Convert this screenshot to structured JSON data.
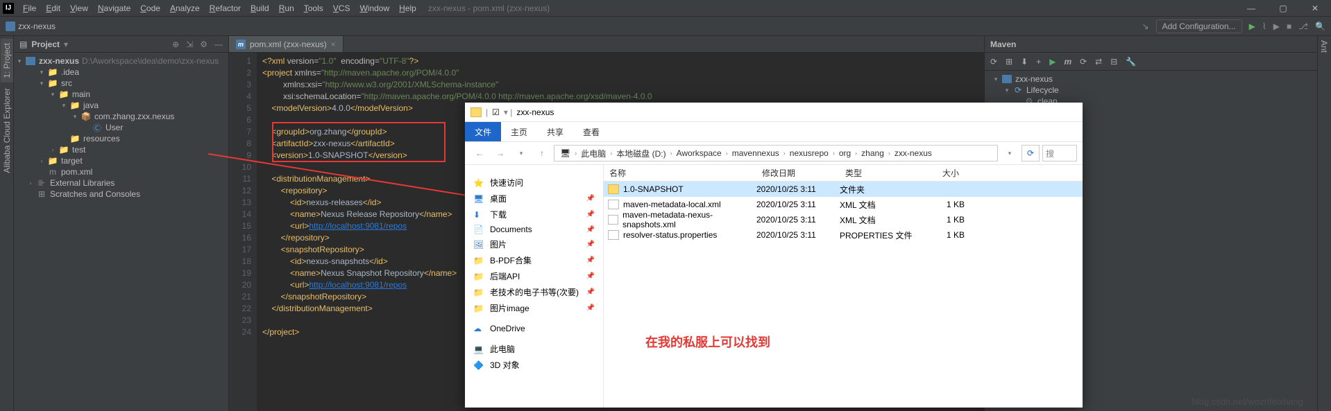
{
  "menu": {
    "items": [
      "File",
      "Edit",
      "View",
      "Navigate",
      "Code",
      "Analyze",
      "Refactor",
      "Build",
      "Run",
      "Tools",
      "VCS",
      "Window",
      "Help"
    ],
    "title": "zxx-nexus - pom.xml (zxx-nexus)"
  },
  "navbar": {
    "crumb": "zxx-nexus",
    "add_conf": "Add Configuration..."
  },
  "project": {
    "title": "Project",
    "root": {
      "label": "zxx-nexus",
      "path": "D:\\Aworkspace\\idea\\demo\\zxx-nexus"
    },
    "tree": [
      {
        "ind": 1,
        "arrow": "▾",
        "icon": "folder",
        "label": ".idea"
      },
      {
        "ind": 1,
        "arrow": "▾",
        "icon": "folder-blue",
        "label": "src"
      },
      {
        "ind": 2,
        "arrow": "▾",
        "icon": "folder-blue",
        "label": "main"
      },
      {
        "ind": 3,
        "arrow": "▾",
        "icon": "folder-blue",
        "label": "java"
      },
      {
        "ind": 4,
        "arrow": "▾",
        "icon": "package",
        "label": "com.zhang.zxx.nexus"
      },
      {
        "ind": 5,
        "arrow": "",
        "icon": "class",
        "label": "User"
      },
      {
        "ind": 3,
        "arrow": "",
        "icon": "folder",
        "label": "resources"
      },
      {
        "ind": 2,
        "arrow": "›",
        "icon": "folder",
        "label": "test"
      },
      {
        "ind": 1,
        "arrow": "›",
        "icon": "folder-orange",
        "label": "target"
      },
      {
        "ind": 1,
        "arrow": "",
        "icon": "maven",
        "label": "pom.xml"
      },
      {
        "ind": 0,
        "arrow": "›",
        "icon": "lib",
        "label": "External Libraries"
      },
      {
        "ind": 0,
        "arrow": "",
        "icon": "scratch",
        "label": "Scratches and Consoles"
      }
    ]
  },
  "editor": {
    "tab": "pom.xml (zxx-nexus)",
    "lines": [
      {
        "n": 1,
        "html": "<span class='tag'>&lt;?xml</span> <span class='attr'>version</span>=<span class='str'>\"1.0\"</span>  <span class='attr'>encoding</span>=<span class='str'>\"UTF-8\"</span><span class='tag'>?&gt;</span>"
      },
      {
        "n": 2,
        "html": "<span class='tag'>&lt;project</span> <span class='attr'>xmlns</span>=<span class='str'>\"http://maven.apache.org/POM/4.0.0\"</span>"
      },
      {
        "n": 3,
        "html": "         <span class='attr'>xmlns:xsi</span>=<span class='str'>\"http://www.w3.org/2001/XMLSchema-instance\"</span>"
      },
      {
        "n": 4,
        "html": "         <span class='attr'>xsi:schemaLocation</span>=<span class='str'>\"http://maven.apache.org/POM/4.0.0 http://maven.apache.org/xsd/maven-4.0.0</span>"
      },
      {
        "n": 5,
        "html": "    <span class='tag'>&lt;modelVersion&gt;</span><span class='txt'>4.0.0</span><span class='tag'>&lt;/modelVersion&gt;</span>"
      },
      {
        "n": 6,
        "html": ""
      },
      {
        "n": 7,
        "html": "    <span class='tag'>&lt;groupId&gt;</span><span class='txt'>org.zhang</span><span class='tag'>&lt;/groupId&gt;</span>"
      },
      {
        "n": 8,
        "html": "    <span class='tag'>&lt;artifactId&gt;</span><span class='txt'>zxx-nexus</span><span class='tag'>&lt;/artifactId&gt;</span>"
      },
      {
        "n": 9,
        "html": "    <span class='tag'>&lt;version&gt;</span><span class='txt'>1.0-SNAPSHOT</span><span class='tag'>&lt;/version&gt;</span>"
      },
      {
        "n": 10,
        "html": ""
      },
      {
        "n": 11,
        "html": "    <span class='tag'>&lt;distributionManagement&gt;</span>"
      },
      {
        "n": 12,
        "html": "        <span class='tag'>&lt;repository&gt;</span>"
      },
      {
        "n": 13,
        "html": "            <span class='tag'>&lt;id&gt;</span><span class='txt'>nexus-releases</span><span class='tag'>&lt;/id&gt;</span>"
      },
      {
        "n": 14,
        "html": "            <span class='tag'>&lt;name&gt;</span><span class='txt'>Nexus Release Repository</span><span class='tag'>&lt;/name&gt;</span>"
      },
      {
        "n": 15,
        "html": "            <span class='tag'>&lt;url&gt;</span><span class='url'>http://localhost:9081/repos</span>"
      },
      {
        "n": 16,
        "html": "        <span class='tag'>&lt;/repository&gt;</span>"
      },
      {
        "n": 17,
        "html": "        <span class='tag'>&lt;snapshotRepository&gt;</span>"
      },
      {
        "n": 18,
        "html": "            <span class='tag'>&lt;id&gt;</span><span class='txt'>nexus-snapshots</span><span class='tag'>&lt;/id&gt;</span>"
      },
      {
        "n": 19,
        "html": "            <span class='tag'>&lt;name&gt;</span><span class='txt'>Nexus Snapshot Repository</span><span class='tag'>&lt;/name&gt;</span>"
      },
      {
        "n": 20,
        "html": "            <span class='tag'>&lt;url&gt;</span><span class='url'>http://localhost:9081/repos</span>"
      },
      {
        "n": 21,
        "html": "        <span class='tag'>&lt;/snapshotRepository&gt;</span>"
      },
      {
        "n": 22,
        "html": "    <span class='tag'>&lt;/distributionManagement&gt;</span>"
      },
      {
        "n": 23,
        "html": ""
      },
      {
        "n": 24,
        "html": "<span class='tag'>&lt;/project&gt;</span>"
      }
    ]
  },
  "maven": {
    "title": "Maven",
    "root": "zxx-nexus",
    "lifecycle": "Lifecycle",
    "clean": "clean"
  },
  "explorer": {
    "title": "zxx-nexus",
    "tabs": [
      "文件",
      "主页",
      "共享",
      "查看"
    ],
    "crumbs": [
      "此电脑",
      "本地磁盘 (D:)",
      "Aworkspace",
      "mavennexus",
      "nexusrepo",
      "org",
      "zhang",
      "zxx-nexus"
    ],
    "search_placeholder": "搜",
    "nav": [
      {
        "label": "快速访问",
        "icon": "star"
      },
      {
        "label": "桌面",
        "icon": "desktop",
        "pin": true
      },
      {
        "label": "下载",
        "icon": "download",
        "pin": true
      },
      {
        "label": "Documents",
        "icon": "doc",
        "pin": true
      },
      {
        "label": "图片",
        "icon": "pic",
        "pin": true
      },
      {
        "label": "B-PDF合集",
        "icon": "folder",
        "pin": true
      },
      {
        "label": "后端API",
        "icon": "folder",
        "pin": true
      },
      {
        "label": "老技术的电子书等(次要)",
        "icon": "folder",
        "pin": true
      },
      {
        "label": "图片image",
        "icon": "folder",
        "pin": true
      },
      {
        "label": "OneDrive",
        "icon": "cloud"
      },
      {
        "label": "此电脑",
        "icon": "pc"
      },
      {
        "label": "3D 对象",
        "icon": "3d"
      }
    ],
    "cols": {
      "name": "名称",
      "date": "修改日期",
      "type": "类型",
      "size": "大小"
    },
    "rows": [
      {
        "sel": true,
        "icon": "folder",
        "name": "1.0-SNAPSHOT",
        "date": "2020/10/25 3:11",
        "type": "文件夹",
        "size": ""
      },
      {
        "icon": "file",
        "name": "maven-metadata-local.xml",
        "date": "2020/10/25 3:11",
        "type": "XML 文档",
        "size": "1 KB"
      },
      {
        "icon": "file",
        "name": "maven-metadata-nexus-snapshots.xml",
        "date": "2020/10/25 3:11",
        "type": "XML 文档",
        "size": "1 KB"
      },
      {
        "icon": "file",
        "name": "resolver-status.properties",
        "date": "2020/10/25 3:11",
        "type": "PROPERTIES 文件",
        "size": "1 KB"
      }
    ]
  },
  "annotation": "在我的私服上可以找到",
  "watermark": "blog.csdn.net/woznfeixhang",
  "sidebar": {
    "project": "1: Project",
    "alibaba": "Alibaba Cloud Explorer",
    "ant": "Ant"
  }
}
